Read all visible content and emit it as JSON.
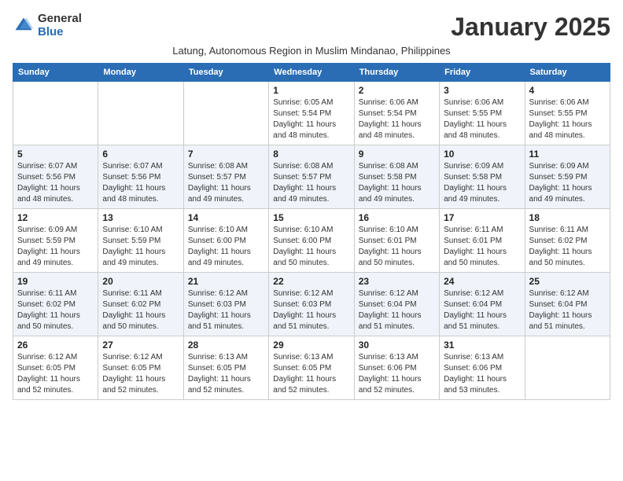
{
  "logo": {
    "general": "General",
    "blue": "Blue"
  },
  "title": "January 2025",
  "subtitle": "Latung, Autonomous Region in Muslim Mindanao, Philippines",
  "days_of_week": [
    "Sunday",
    "Monday",
    "Tuesday",
    "Wednesday",
    "Thursday",
    "Friday",
    "Saturday"
  ],
  "weeks": [
    [
      {
        "day": "",
        "info": ""
      },
      {
        "day": "",
        "info": ""
      },
      {
        "day": "",
        "info": ""
      },
      {
        "day": "1",
        "info": "Sunrise: 6:05 AM\nSunset: 5:54 PM\nDaylight: 11 hours\nand 48 minutes."
      },
      {
        "day": "2",
        "info": "Sunrise: 6:06 AM\nSunset: 5:54 PM\nDaylight: 11 hours\nand 48 minutes."
      },
      {
        "day": "3",
        "info": "Sunrise: 6:06 AM\nSunset: 5:55 PM\nDaylight: 11 hours\nand 48 minutes."
      },
      {
        "day": "4",
        "info": "Sunrise: 6:06 AM\nSunset: 5:55 PM\nDaylight: 11 hours\nand 48 minutes."
      }
    ],
    [
      {
        "day": "5",
        "info": "Sunrise: 6:07 AM\nSunset: 5:56 PM\nDaylight: 11 hours\nand 48 minutes."
      },
      {
        "day": "6",
        "info": "Sunrise: 6:07 AM\nSunset: 5:56 PM\nDaylight: 11 hours\nand 48 minutes."
      },
      {
        "day": "7",
        "info": "Sunrise: 6:08 AM\nSunset: 5:57 PM\nDaylight: 11 hours\nand 49 minutes."
      },
      {
        "day": "8",
        "info": "Sunrise: 6:08 AM\nSunset: 5:57 PM\nDaylight: 11 hours\nand 49 minutes."
      },
      {
        "day": "9",
        "info": "Sunrise: 6:08 AM\nSunset: 5:58 PM\nDaylight: 11 hours\nand 49 minutes."
      },
      {
        "day": "10",
        "info": "Sunrise: 6:09 AM\nSunset: 5:58 PM\nDaylight: 11 hours\nand 49 minutes."
      },
      {
        "day": "11",
        "info": "Sunrise: 6:09 AM\nSunset: 5:59 PM\nDaylight: 11 hours\nand 49 minutes."
      }
    ],
    [
      {
        "day": "12",
        "info": "Sunrise: 6:09 AM\nSunset: 5:59 PM\nDaylight: 11 hours\nand 49 minutes."
      },
      {
        "day": "13",
        "info": "Sunrise: 6:10 AM\nSunset: 5:59 PM\nDaylight: 11 hours\nand 49 minutes."
      },
      {
        "day": "14",
        "info": "Sunrise: 6:10 AM\nSunset: 6:00 PM\nDaylight: 11 hours\nand 49 minutes."
      },
      {
        "day": "15",
        "info": "Sunrise: 6:10 AM\nSunset: 6:00 PM\nDaylight: 11 hours\nand 50 minutes."
      },
      {
        "day": "16",
        "info": "Sunrise: 6:10 AM\nSunset: 6:01 PM\nDaylight: 11 hours\nand 50 minutes."
      },
      {
        "day": "17",
        "info": "Sunrise: 6:11 AM\nSunset: 6:01 PM\nDaylight: 11 hours\nand 50 minutes."
      },
      {
        "day": "18",
        "info": "Sunrise: 6:11 AM\nSunset: 6:02 PM\nDaylight: 11 hours\nand 50 minutes."
      }
    ],
    [
      {
        "day": "19",
        "info": "Sunrise: 6:11 AM\nSunset: 6:02 PM\nDaylight: 11 hours\nand 50 minutes."
      },
      {
        "day": "20",
        "info": "Sunrise: 6:11 AM\nSunset: 6:02 PM\nDaylight: 11 hours\nand 50 minutes."
      },
      {
        "day": "21",
        "info": "Sunrise: 6:12 AM\nSunset: 6:03 PM\nDaylight: 11 hours\nand 51 minutes."
      },
      {
        "day": "22",
        "info": "Sunrise: 6:12 AM\nSunset: 6:03 PM\nDaylight: 11 hours\nand 51 minutes."
      },
      {
        "day": "23",
        "info": "Sunrise: 6:12 AM\nSunset: 6:04 PM\nDaylight: 11 hours\nand 51 minutes."
      },
      {
        "day": "24",
        "info": "Sunrise: 6:12 AM\nSunset: 6:04 PM\nDaylight: 11 hours\nand 51 minutes."
      },
      {
        "day": "25",
        "info": "Sunrise: 6:12 AM\nSunset: 6:04 PM\nDaylight: 11 hours\nand 51 minutes."
      }
    ],
    [
      {
        "day": "26",
        "info": "Sunrise: 6:12 AM\nSunset: 6:05 PM\nDaylight: 11 hours\nand 52 minutes."
      },
      {
        "day": "27",
        "info": "Sunrise: 6:12 AM\nSunset: 6:05 PM\nDaylight: 11 hours\nand 52 minutes."
      },
      {
        "day": "28",
        "info": "Sunrise: 6:13 AM\nSunset: 6:05 PM\nDaylight: 11 hours\nand 52 minutes."
      },
      {
        "day": "29",
        "info": "Sunrise: 6:13 AM\nSunset: 6:05 PM\nDaylight: 11 hours\nand 52 minutes."
      },
      {
        "day": "30",
        "info": "Sunrise: 6:13 AM\nSunset: 6:06 PM\nDaylight: 11 hours\nand 52 minutes."
      },
      {
        "day": "31",
        "info": "Sunrise: 6:13 AM\nSunset: 6:06 PM\nDaylight: 11 hours\nand 53 minutes."
      },
      {
        "day": "",
        "info": ""
      }
    ]
  ]
}
